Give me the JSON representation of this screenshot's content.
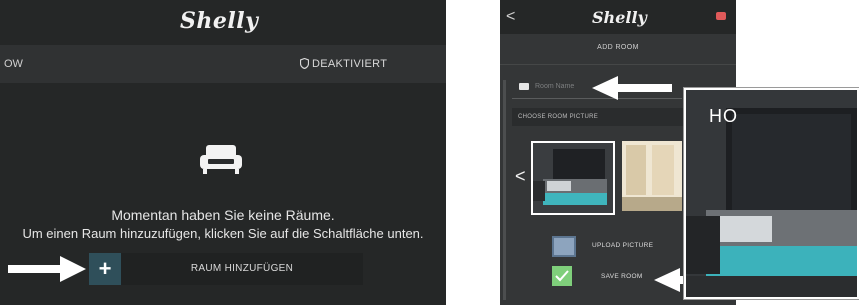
{
  "left_screen": {
    "logo": "Shelly",
    "subbar_left": "OW",
    "subbar_right": "DEAKTIVIERT",
    "empty_line1": "Momentan haben Sie keine Räume.",
    "empty_line2": "Um einen Raum hinzuzufügen, klicken Sie auf die Schaltfläche unten.",
    "add_button_plus": "+",
    "add_button_label": "RAUM HINZUFÜGEN"
  },
  "right_screen": {
    "back_icon": "<",
    "logo": "Shelly",
    "title": "ADD ROOM",
    "name_placeholder": "Room Name",
    "picture_section_label": "CHOOSE ROOM PICTURE",
    "carousel_prev": "<",
    "upload_label": "UPLOAD PICTURE",
    "save_label": "SAVE ROOM"
  },
  "zoom_overlay": {
    "text": "HO"
  },
  "icons": {
    "shield": "shield-icon",
    "sofa": "sofa-icon",
    "plus": "plus-icon",
    "back": "back-chevron-icon",
    "user": "user-icon",
    "mail": "envelope-icon",
    "chevron_left": "chevron-left-icon",
    "upload": "image-upload-icon",
    "save": "save-check-icon",
    "arrow": "pointer-arrow-icon"
  },
  "colors": {
    "panel_dark": "#2a2c2d",
    "header": "#252727",
    "accent_teal": "#2f4f5a",
    "save_green": "#7fcf7b",
    "text_light": "#e6e6e6"
  }
}
